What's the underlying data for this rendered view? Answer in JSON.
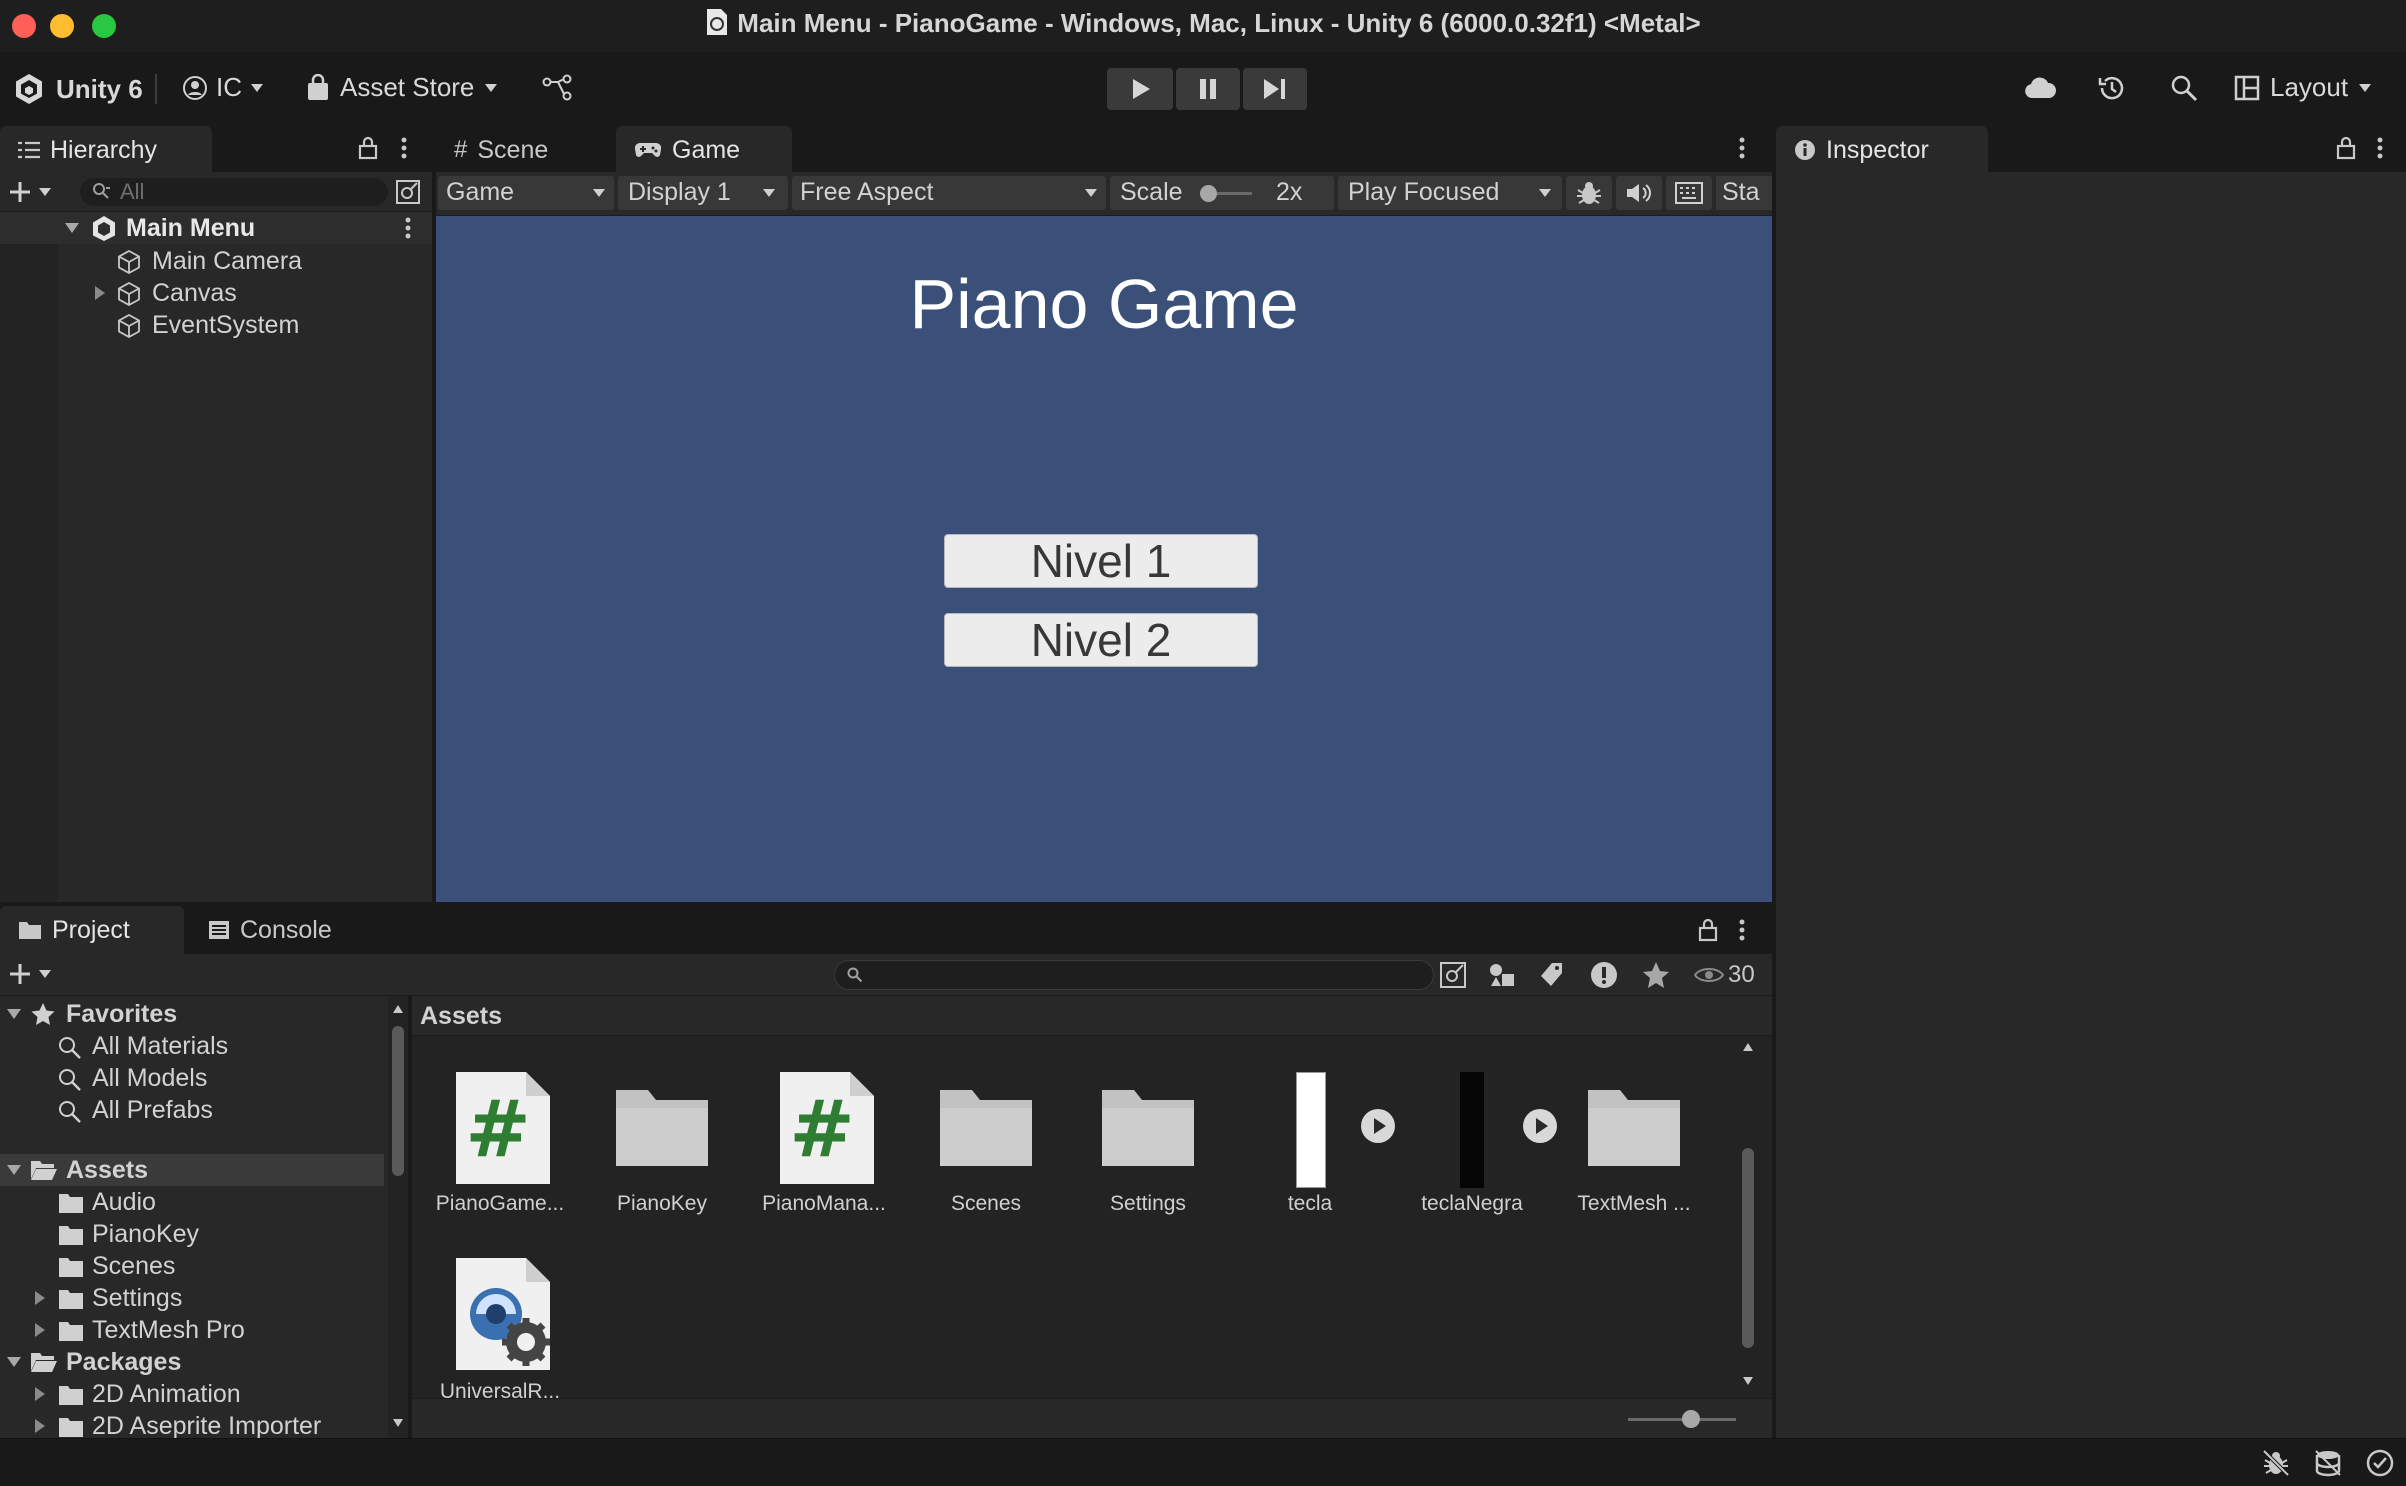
{
  "window": {
    "title": "Main Menu - PianoGame - Windows, Mac, Linux - Unity 6 (6000.0.32f1) <Metal>"
  },
  "toolbar": {
    "unity_label": "Unity 6",
    "account_label": "IC",
    "asset_store_label": "Asset Store",
    "layout_label": "Layout"
  },
  "hierarchy": {
    "tab_label": "Hierarchy",
    "search_placeholder": "All",
    "scene_name": "Main Menu",
    "items": [
      {
        "label": "Main Camera"
      },
      {
        "label": "Canvas"
      },
      {
        "label": "EventSystem"
      }
    ]
  },
  "scene_tab": {
    "label": "Scene"
  },
  "game_tab": {
    "label": "Game",
    "mode": "Game",
    "display": "Display 1",
    "aspect": "Free Aspect",
    "scale_label": "Scale",
    "scale_value": "2x",
    "play_mode": "Play Focused",
    "stats_label": "Sta"
  },
  "game_view": {
    "title": "Piano Game",
    "buttons": [
      {
        "label": "Nivel 1"
      },
      {
        "label": "Nivel 2"
      }
    ],
    "background_color": "#3a5079"
  },
  "inspector": {
    "tab_label": "Inspector"
  },
  "project": {
    "tab_label": "Project",
    "console_label": "Console",
    "visible_count": "30",
    "favorites": {
      "label": "Favorites",
      "items": [
        {
          "label": "All Materials"
        },
        {
          "label": "All Models"
        },
        {
          "label": "All Prefabs"
        }
      ]
    },
    "assets_tree": {
      "label": "Assets",
      "items": [
        {
          "label": "Audio"
        },
        {
          "label": "PianoKey"
        },
        {
          "label": "Scenes"
        },
        {
          "label": "Settings"
        },
        {
          "label": "TextMesh Pro"
        }
      ]
    },
    "packages_tree": {
      "label": "Packages",
      "items": [
        {
          "label": "2D Animation"
        },
        {
          "label": "2D Aseprite Importer"
        }
      ]
    },
    "breadcrumb": "Assets",
    "assets": [
      {
        "label": "PianoGame...",
        "icon": "csharp-script-icon"
      },
      {
        "label": "PianoKey",
        "icon": "folder-icon"
      },
      {
        "label": "PianoMana...",
        "icon": "csharp-script-icon"
      },
      {
        "label": "Scenes",
        "icon": "folder-icon"
      },
      {
        "label": "Settings",
        "icon": "folder-icon"
      },
      {
        "label": "tecla",
        "icon": "prefab-white-icon"
      },
      {
        "label": "teclaNegra",
        "icon": "prefab-black-icon"
      },
      {
        "label": "TextMesh ...",
        "icon": "folder-icon"
      },
      {
        "label": "UniversalR...",
        "icon": "render-pipeline-asset-icon"
      }
    ]
  },
  "colors": {
    "accent_script": "#2e7d32",
    "panel_bg": "#282828",
    "toolbar_bg": "#191919"
  }
}
